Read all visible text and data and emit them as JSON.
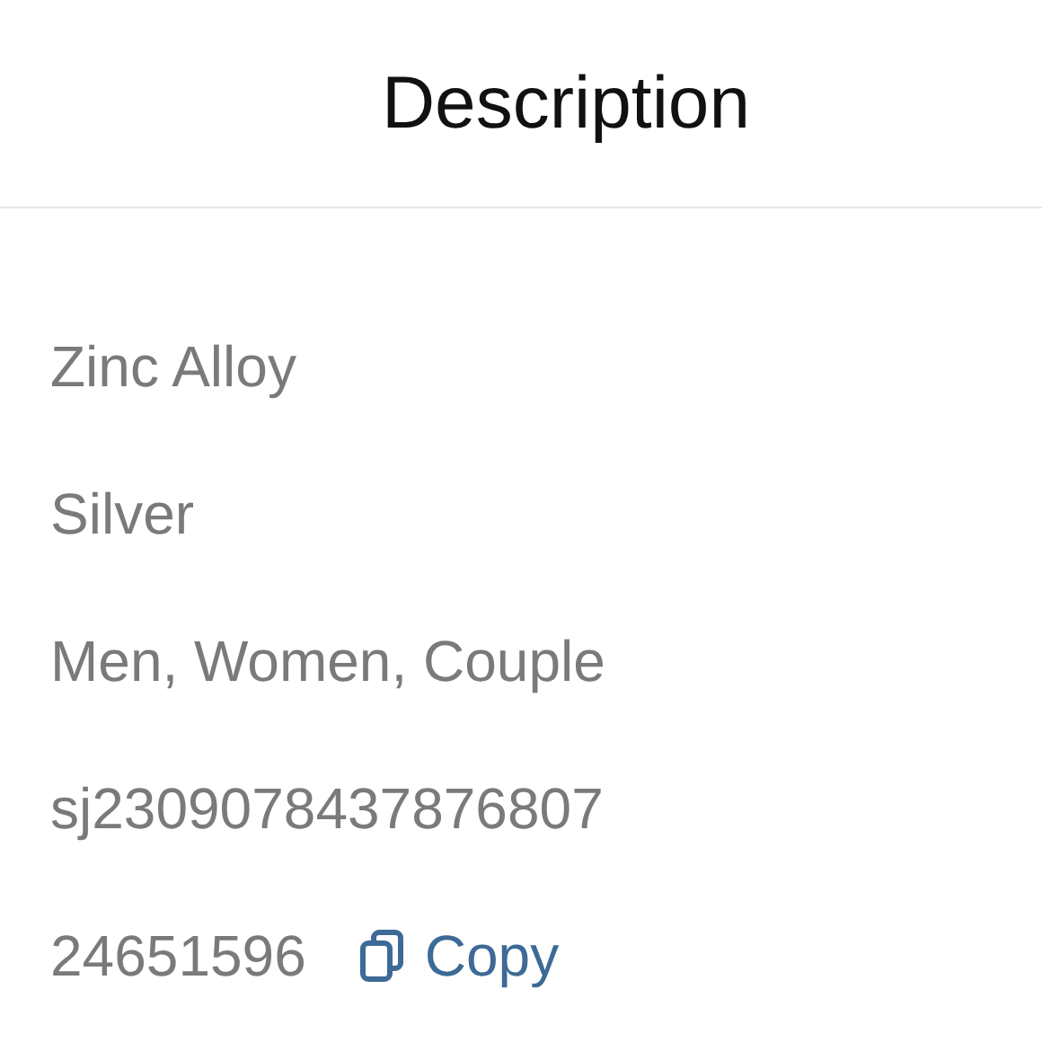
{
  "header": {
    "title": "Description"
  },
  "details": [
    {
      "value": "Zinc Alloy"
    },
    {
      "value": "Silver"
    },
    {
      "value": "Men, Women, Couple"
    },
    {
      "value": "sj2309078437876807"
    },
    {
      "value": "24651596",
      "copy_label": "Copy"
    }
  ]
}
